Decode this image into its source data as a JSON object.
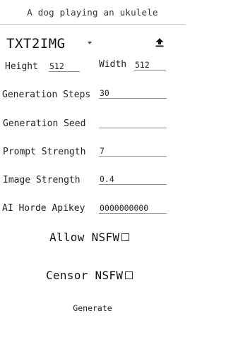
{
  "prompt": "A dog playing an ukulele",
  "mode": {
    "selected": "TXT2IMG",
    "icons": {
      "dropdown": "chevron-down-icon",
      "upload": "upload-icon"
    }
  },
  "fields": {
    "height": {
      "label": "Height",
      "value": "512"
    },
    "width": {
      "label": "Width",
      "value": "512"
    },
    "steps": {
      "label": "Generation Steps",
      "value": "30"
    },
    "seed": {
      "label": "Generation Seed",
      "value": ""
    },
    "prompt_strength": {
      "label": "Prompt Strength",
      "value": "7"
    },
    "image_strength": {
      "label": "Image Strength",
      "value": "0.4"
    },
    "apikey": {
      "label": "AI Horde Apikey",
      "value": "0000000000"
    }
  },
  "toggles": {
    "allow_nsfw": {
      "label": "Allow NSFW",
      "checked": false
    },
    "censor_nsfw": {
      "label": "Censor NSFW",
      "checked": false
    }
  },
  "actions": {
    "generate_label": "Generate"
  }
}
